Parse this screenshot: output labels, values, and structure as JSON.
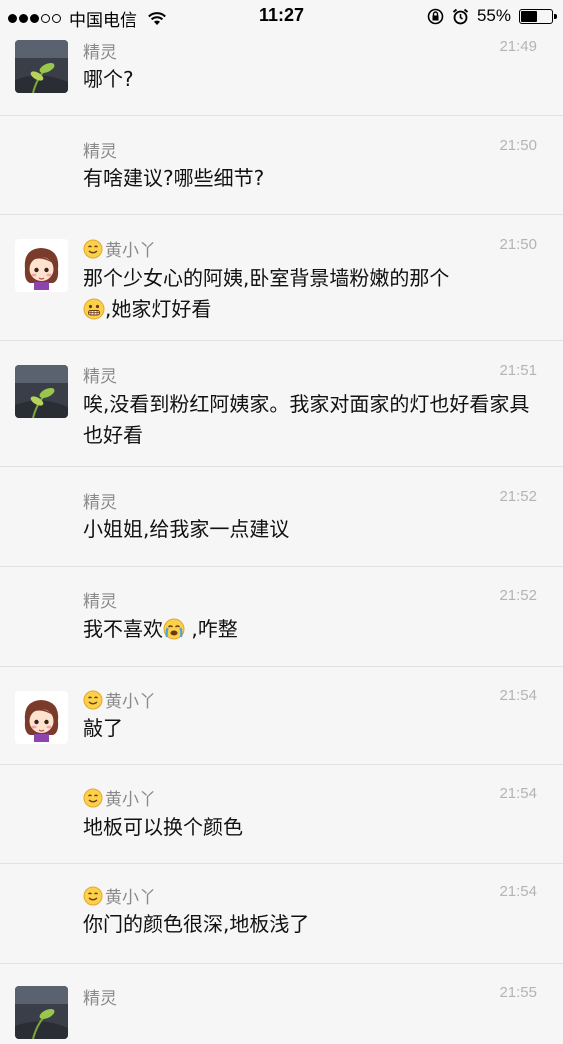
{
  "status_bar": {
    "carrier": "中国电信",
    "time": "11:27",
    "battery_percent": "55%",
    "battery_level": 0.55,
    "signal_icon": "signal-dots-icon",
    "wifi_icon": "wifi-icon"
  },
  "messages": [
    {
      "sender": "精灵",
      "time": "21:49",
      "parts": [
        "哪个?"
      ]
    },
    {
      "sender": "精灵",
      "time": "21:50",
      "parts": [
        "有啥建议?哪些细节?"
      ]
    },
    {
      "sender": "黄小丫",
      "time": "21:50",
      "parts": [
        "那个少女心的阿姨,卧室背景墙粉嫩的那个",
        ",她家灯好看"
      ]
    },
    {
      "sender": "精灵",
      "time": "21:51",
      "parts": [
        "唉,没看到粉红阿姨家。我家对面家的灯也好看家具也好看"
      ]
    },
    {
      "sender": "精灵",
      "time": "21:52",
      "parts": [
        "小姐姐,给我家一点建议"
      ]
    },
    {
      "sender": "精灵",
      "time": "21:52",
      "parts": [
        "我不喜欢",
        " ,咋整"
      ]
    },
    {
      "sender": "黄小丫",
      "time": "21:54",
      "parts": [
        "敲了"
      ]
    },
    {
      "sender": "黄小丫",
      "time": "21:54",
      "parts": [
        "地板可以换个颜色"
      ]
    },
    {
      "sender": "黄小丫",
      "time": "21:54",
      "parts": [
        "你门的颜色很深,地板浅了"
      ]
    },
    {
      "sender": "精灵",
      "time": "21:55",
      "parts": [
        ""
      ]
    }
  ]
}
